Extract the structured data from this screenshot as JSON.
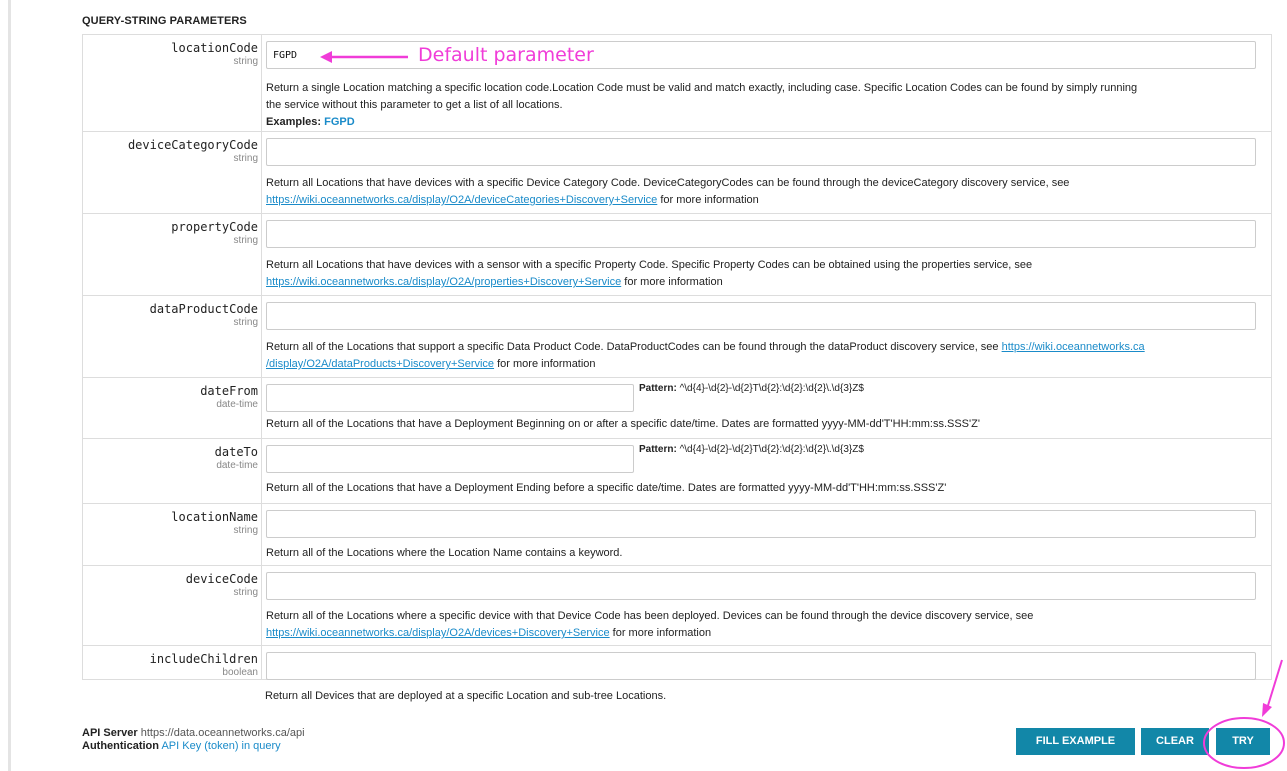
{
  "section_title": "QUERY-STRING PARAMETERS",
  "annotation": {
    "default_label": "Default parameter",
    "color": "#f03cd8"
  },
  "params": [
    {
      "name": "locationCode",
      "type": "string",
      "value": "FGPD",
      "desc_lines": [
        "Return a single Location matching a specific location code.Location Code must be valid and match exactly, including case. Specific Location Codes can be found by simply running",
        "the service without this parameter to get a list of all locations."
      ],
      "examples_label": "Examples:",
      "examples_value": "FGPD"
    },
    {
      "name": "deviceCategoryCode",
      "type": "string",
      "value": "",
      "desc_text": "Return all Locations that have devices with a specific Device Category Code. DeviceCategoryCodes can be found through the deviceCategory discovery service, see",
      "desc_link": "https://wiki.oceannetworks.ca/display/O2A/deviceCategories+Discovery+Service",
      "desc_tail": " for more information"
    },
    {
      "name": "propertyCode",
      "type": "string",
      "value": "",
      "desc_text": "Return all Locations that have devices with a sensor with a specific Property Code. Specific Property Codes can be obtained using the properties service, see",
      "desc_link": "https://wiki.oceannetworks.ca/display/O2A/properties+Discovery+Service",
      "desc_tail": " for more information"
    },
    {
      "name": "dataProductCode",
      "type": "string",
      "value": "",
      "desc_text": "Return all of the Locations that support a specific Data Product Code. DataProductCodes can be found through the dataProduct discovery service, see ",
      "desc_link_a": "https://wiki.oceannetworks.ca",
      "desc_link_b": "/display/O2A/dataProducts+Discovery+Service",
      "desc_tail": " for more information"
    },
    {
      "name": "dateFrom",
      "type": "date-time",
      "value": "",
      "pattern_label": "Pattern:",
      "pattern": "^\\d{4}-\\d{2}-\\d{2}T\\d{2}:\\d{2}:\\d{2}\\.\\d{3}Z$",
      "desc": "Return all of the Locations that have a Deployment Beginning on or after a specific date/time. Dates are formatted yyyy-MM-dd'T'HH:mm:ss.SSS'Z'"
    },
    {
      "name": "dateTo",
      "type": "date-time",
      "value": "",
      "pattern_label": "Pattern:",
      "pattern": "^\\d{4}-\\d{2}-\\d{2}T\\d{2}:\\d{2}:\\d{2}\\.\\d{3}Z$",
      "desc": "Return all of the Locations that have a Deployment Ending before a specific date/time. Dates are formatted yyyy-MM-dd'T'HH:mm:ss.SSS'Z'"
    },
    {
      "name": "locationName",
      "type": "string",
      "value": "",
      "desc": "Return all of the Locations where the Location Name contains a keyword."
    },
    {
      "name": "deviceCode",
      "type": "string",
      "value": "",
      "desc_text": "Return all of the Locations where a specific device with that Device Code has been deployed. Devices can be found through the device discovery service, see",
      "desc_link": "https://wiki.oceannetworks.ca/display/O2A/devices+Discovery+Service",
      "desc_tail": " for more information"
    },
    {
      "name": "includeChildren",
      "type": "boolean",
      "value": "",
      "desc": "Return all Devices that are deployed at a specific Location and sub-tree Locations."
    }
  ],
  "footer": {
    "api_server_label": "API Server",
    "api_server_value": "https://data.oceannetworks.ca/api",
    "auth_label": "Authentication",
    "auth_value": "API Key (token) in query"
  },
  "buttons": {
    "fill_example": "FILL EXAMPLE",
    "clear": "CLEAR",
    "try": "TRY"
  },
  "colors": {
    "button_bg": "#1287a8",
    "link": "#1a8bc9",
    "annotation": "#f03cd8"
  }
}
